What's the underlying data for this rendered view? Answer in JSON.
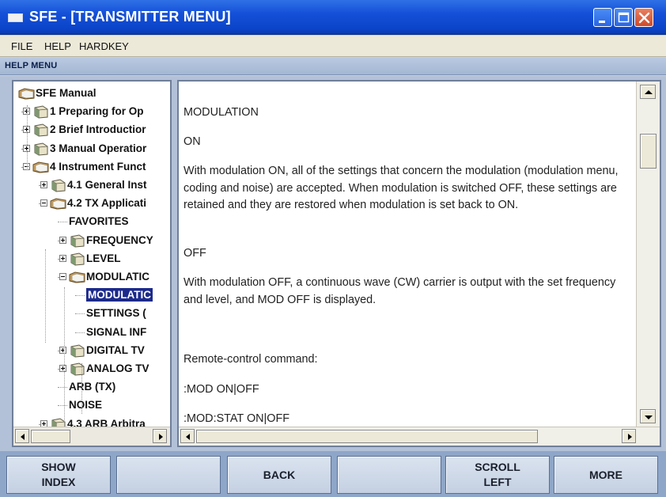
{
  "window": {
    "title": "SFE - [TRANSMITTER MENU]",
    "controls": [
      "minimize-icon",
      "maximize-icon",
      "close-icon"
    ]
  },
  "menubar": {
    "file": "FILE",
    "help": "HELP",
    "hardkey": "HARDKEY"
  },
  "help_panel": {
    "title": "HELP MENU"
  },
  "tree": {
    "items": [
      {
        "label": "SFE Manual",
        "depth": 0,
        "expander": "none",
        "icon": "open-book-icon"
      },
      {
        "label": "1 Preparing for Op",
        "depth": 1,
        "expander": "plus",
        "icon": "book-icon"
      },
      {
        "label": "2 Brief Introductior",
        "depth": 1,
        "expander": "plus",
        "icon": "book-icon"
      },
      {
        "label": "3 Manual Operatior",
        "depth": 1,
        "expander": "plus",
        "icon": "book-icon"
      },
      {
        "label": "4 Instrument Funct",
        "depth": 1,
        "expander": "minus",
        "icon": "open-book-icon"
      },
      {
        "label": "4.1 General Inst",
        "depth": 2,
        "expander": "plus",
        "icon": "book-icon"
      },
      {
        "label": "4.2 TX Applicati",
        "depth": 2,
        "expander": "minus",
        "icon": "open-book-icon"
      },
      {
        "label": "FAVORITES",
        "depth": 3,
        "expander": "none",
        "icon": "none"
      },
      {
        "label": "FREQUENCY",
        "depth": 3,
        "expander": "plus",
        "icon": "book-icon"
      },
      {
        "label": "LEVEL",
        "depth": 3,
        "expander": "plus",
        "icon": "book-icon"
      },
      {
        "label": "MODULATIC",
        "depth": 3,
        "expander": "minus",
        "icon": "open-book-icon"
      },
      {
        "label": "MODULATIC",
        "depth": 4,
        "expander": "none",
        "icon": "none",
        "selected": true
      },
      {
        "label": "SETTINGS (",
        "depth": 4,
        "expander": "none",
        "icon": "none"
      },
      {
        "label": "SIGNAL INF",
        "depth": 4,
        "expander": "none",
        "icon": "none"
      },
      {
        "label": "DIGITAL TV",
        "depth": 3,
        "expander": "plus",
        "icon": "book-icon"
      },
      {
        "label": "ANALOG TV",
        "depth": 3,
        "expander": "plus",
        "icon": "book-icon"
      },
      {
        "label": "ARB (TX)",
        "depth": 3,
        "expander": "none",
        "icon": "none"
      },
      {
        "label": "NOISE",
        "depth": 3,
        "expander": "none",
        "icon": "none"
      },
      {
        "label": "4.3 ARB Arbitra",
        "depth": 2,
        "expander": "plus",
        "icon": "book-icon"
      }
    ]
  },
  "document": {
    "paragraphs": [
      "MODULATION",
      "ON",
      "With modulation ON, all of the settings that concern the modulation (modulation menu, coding and noise) are accepted. When modulation is switched OFF, these settings are retained and they are restored when modulation is set back to ON.",
      "OFF",
      "With modulation OFF, a continuous wave (CW) carrier is output with the set frequency and level, and MOD OFF is displayed.",
      "Remote-control command:",
      ":MOD ON|OFF",
      ":MOD:STAT ON|OFF"
    ]
  },
  "softkeys": {
    "show_index": "SHOW\nINDEX",
    "blank_1": "",
    "back": "BACK",
    "blank_2": "",
    "scroll_left": "SCROLL\nLEFT",
    "more": "MORE"
  },
  "colors": {
    "titlebar": "#1450d8",
    "selection": "#1c2a8c",
    "softkey_bg": "#c4d0e2"
  }
}
